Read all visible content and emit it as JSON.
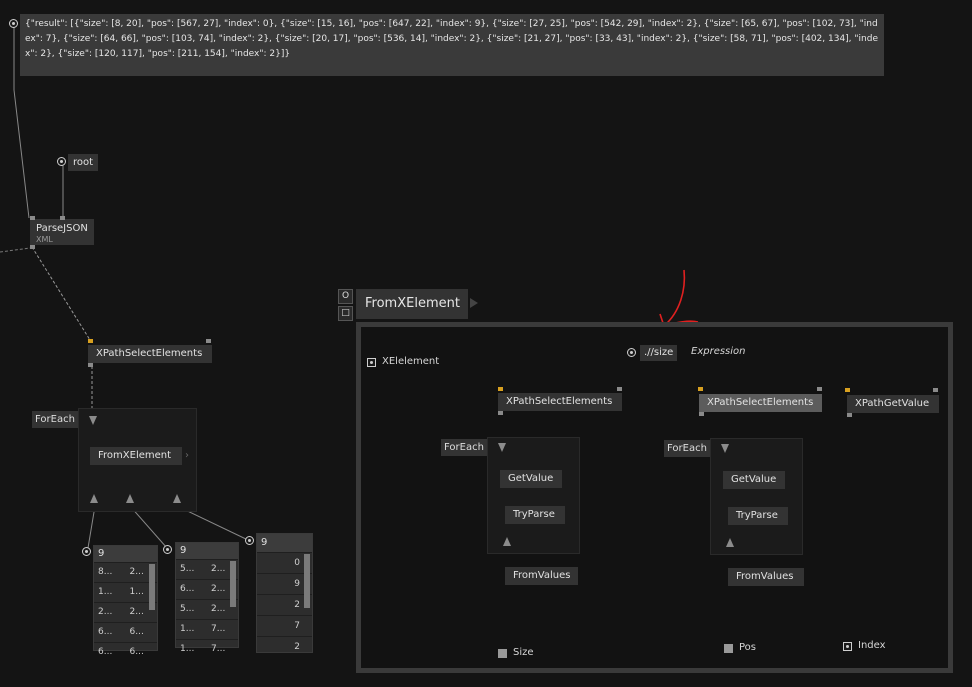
{
  "result_text": "{\"result\": [{\"size\": [8, 20], \"pos\": [567, 27], \"index\": 0}, {\"size\": [15, 16], \"pos\": [647, 22], \"index\": 9}, {\"size\": [27, 25], \"pos\": [542, 29], \"index\": 2}, {\"size\": [65, 67], \"pos\": [102, 73], \"index\": 7}, {\"size\": [64, 66], \"pos\": [103, 74], \"index\": 2}, {\"size\": [20, 17], \"pos\": [536, 14], \"index\": 2}, {\"size\": [21, 27], \"pos\": [33, 43], \"index\": 2}, {\"size\": [58, 71], \"pos\": [402, 134], \"index\": 2}, {\"size\": [120, 117], \"pos\": [211, 154], \"index\": 2}]}",
  "left": {
    "root_label": "root",
    "parsejson": {
      "title": "ParseJSON",
      "sub": "XML"
    },
    "xpath": "XPathSelectElements",
    "foreach": "ForEach",
    "fromxelement": "FromXElement",
    "spread1": {
      "count": "9",
      "rows": [
        [
          "8...",
          "2..."
        ],
        [
          "1...",
          "1..."
        ],
        [
          "2...",
          "2..."
        ],
        [
          "6...",
          "6..."
        ],
        [
          "6...",
          "6..."
        ]
      ]
    },
    "spread2": {
      "count": "9",
      "rows": [
        [
          "5...",
          "2..."
        ],
        [
          "6...",
          "2..."
        ],
        [
          "5...",
          "2..."
        ],
        [
          "1...",
          "7..."
        ],
        [
          "1...",
          "7..."
        ]
      ]
    },
    "spread3": {
      "count": "9",
      "rows": [
        "0",
        "9",
        "2",
        "7",
        "2"
      ]
    }
  },
  "patch": {
    "buttons": {
      "o": "O",
      "sq": "□"
    },
    "title": "FromXElement",
    "xelement": "XElelement",
    "expr_value": ".//size",
    "expr_label": "Expression",
    "xpath1": "XPathSelectElements",
    "xpath2": "XPathSelectElements",
    "xpathvalue": "XPathGetValue",
    "foreach1": "ForEach",
    "foreach2": "ForEach",
    "getvalue1": "GetValue",
    "getvalue2": "GetValue",
    "tryparse1": "TryParse",
    "tryparse2": "TryParse",
    "fromvalues1": "FromValues",
    "fromvalues2": "FromValues",
    "out_size": "Size",
    "out_pos": "Pos",
    "out_index": "Index"
  },
  "colors": {
    "background": "#141414",
    "node": "#333333",
    "accent_pin": "#d8a020",
    "annotation": "#e02020"
  }
}
